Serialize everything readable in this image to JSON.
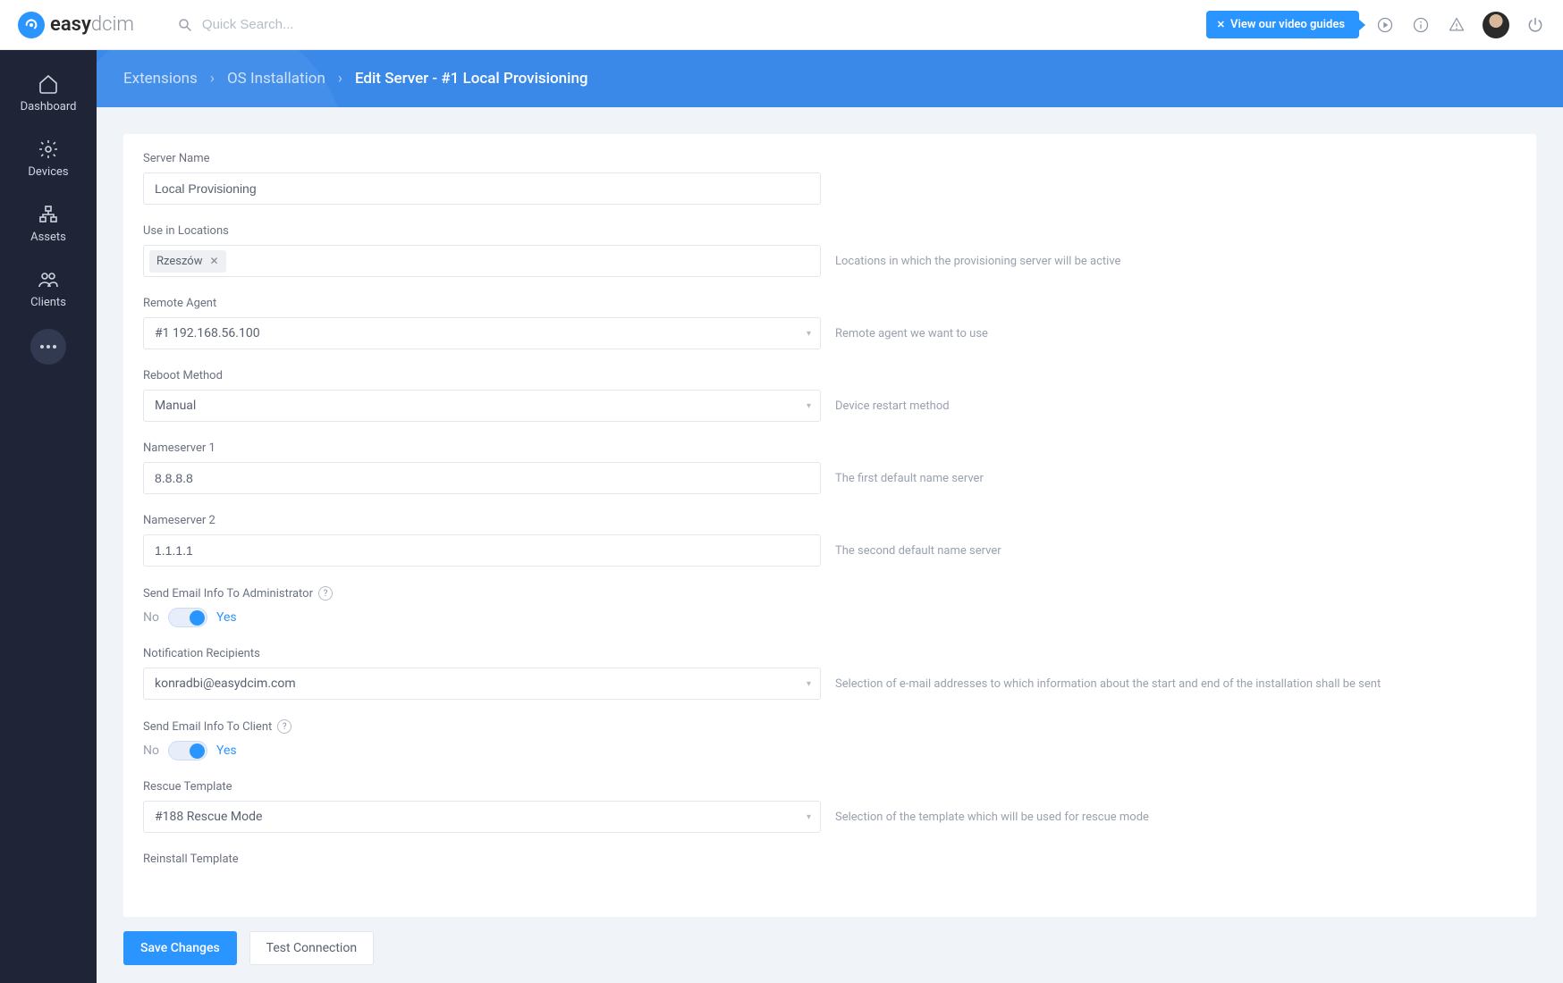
{
  "brand": {
    "name1": "easy",
    "name2": "dcim"
  },
  "search": {
    "placeholder": "Quick Search..."
  },
  "topbar": {
    "video_guides": "View our video guides"
  },
  "sidebar": {
    "items": [
      {
        "label": "Dashboard"
      },
      {
        "label": "Devices"
      },
      {
        "label": "Assets"
      },
      {
        "label": "Clients"
      }
    ]
  },
  "breadcrumbs": {
    "a": "Extensions",
    "b": "OS Installation",
    "c": "Edit Server - #1 Local Provisioning"
  },
  "form": {
    "server_name": {
      "label": "Server Name",
      "value": "Local Provisioning"
    },
    "locations": {
      "label": "Use in Locations",
      "tag": "Rzeszów",
      "hint": "Locations in which the provisioning server will be active"
    },
    "remote_agent": {
      "label": "Remote Agent",
      "value": "#1 192.168.56.100",
      "hint": "Remote agent we want to use"
    },
    "reboot": {
      "label": "Reboot Method",
      "value": "Manual",
      "hint": "Device restart method"
    },
    "ns1": {
      "label": "Nameserver 1",
      "value": "8.8.8.8",
      "hint": "The first default name server"
    },
    "ns2": {
      "label": "Nameserver 2",
      "value": "1.1.1.1",
      "hint": "The second default name server"
    },
    "email_admin": {
      "label": "Send Email Info To Administrator",
      "no": "No",
      "yes": "Yes"
    },
    "recipients": {
      "label": "Notification Recipients",
      "value": "konradbi@easydcim.com",
      "hint": "Selection of e-mail addresses to which information about the start and end of the installation shall be sent"
    },
    "email_client": {
      "label": "Send Email Info To Client",
      "no": "No",
      "yes": "Yes"
    },
    "rescue": {
      "label": "Rescue Template",
      "value": "#188 Rescue Mode",
      "hint": "Selection of the template which will be used for rescue mode"
    },
    "reinstall": {
      "label": "Reinstall Template"
    }
  },
  "footer": {
    "save": "Save Changes",
    "test": "Test Connection"
  }
}
